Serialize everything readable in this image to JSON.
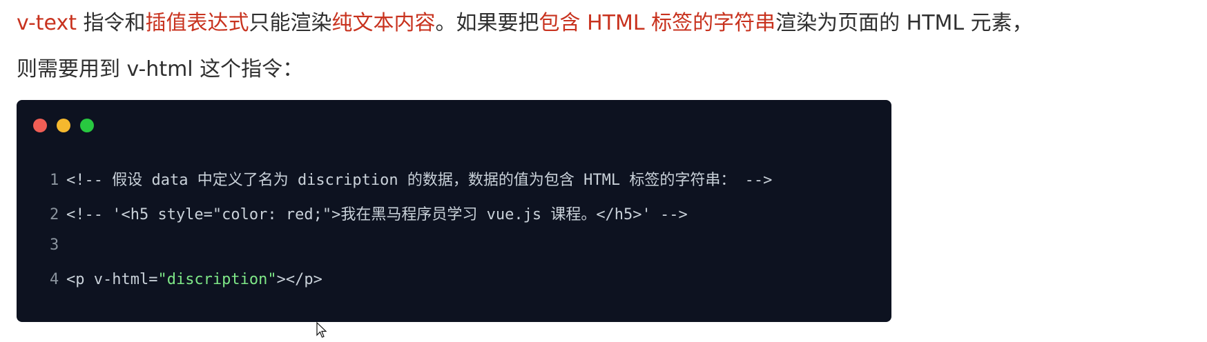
{
  "paragraph1": {
    "t1": "v-text",
    "t2": " 指令和",
    "t3": "插值表达式",
    "t4": "只能渲染",
    "t5": "纯文本内容",
    "t6": "。如果要把",
    "t7": "包含 HTML 标签的字符串",
    "t8": "渲染为页面的 HTML 元素，"
  },
  "paragraph2": {
    "text": "则需要用到 v-html 这个指令："
  },
  "code": {
    "dots": {
      "red": "#ef5e55",
      "yellow": "#f5b82e",
      "green": "#28c840"
    },
    "colors": {
      "comment": "#c9d1d9",
      "tag": "#c9d1d9",
      "string": "#7ee787"
    },
    "lines": [
      {
        "num": "1",
        "text": "<!-- 假设 data 中定义了名为 discription 的数据，数据的值为包含 HTML 标签的字符串： -->"
      },
      {
        "num": "2",
        "text": "<!-- '<h5 style=\"color: red;\">我在黑马程序员学习 vue.js 课程。</h5>' -->"
      },
      {
        "num": "3",
        "text": ""
      },
      {
        "num": "4",
        "pre": "<p v-html=",
        "str": "\"discription\"",
        "post": "></p>"
      }
    ]
  }
}
